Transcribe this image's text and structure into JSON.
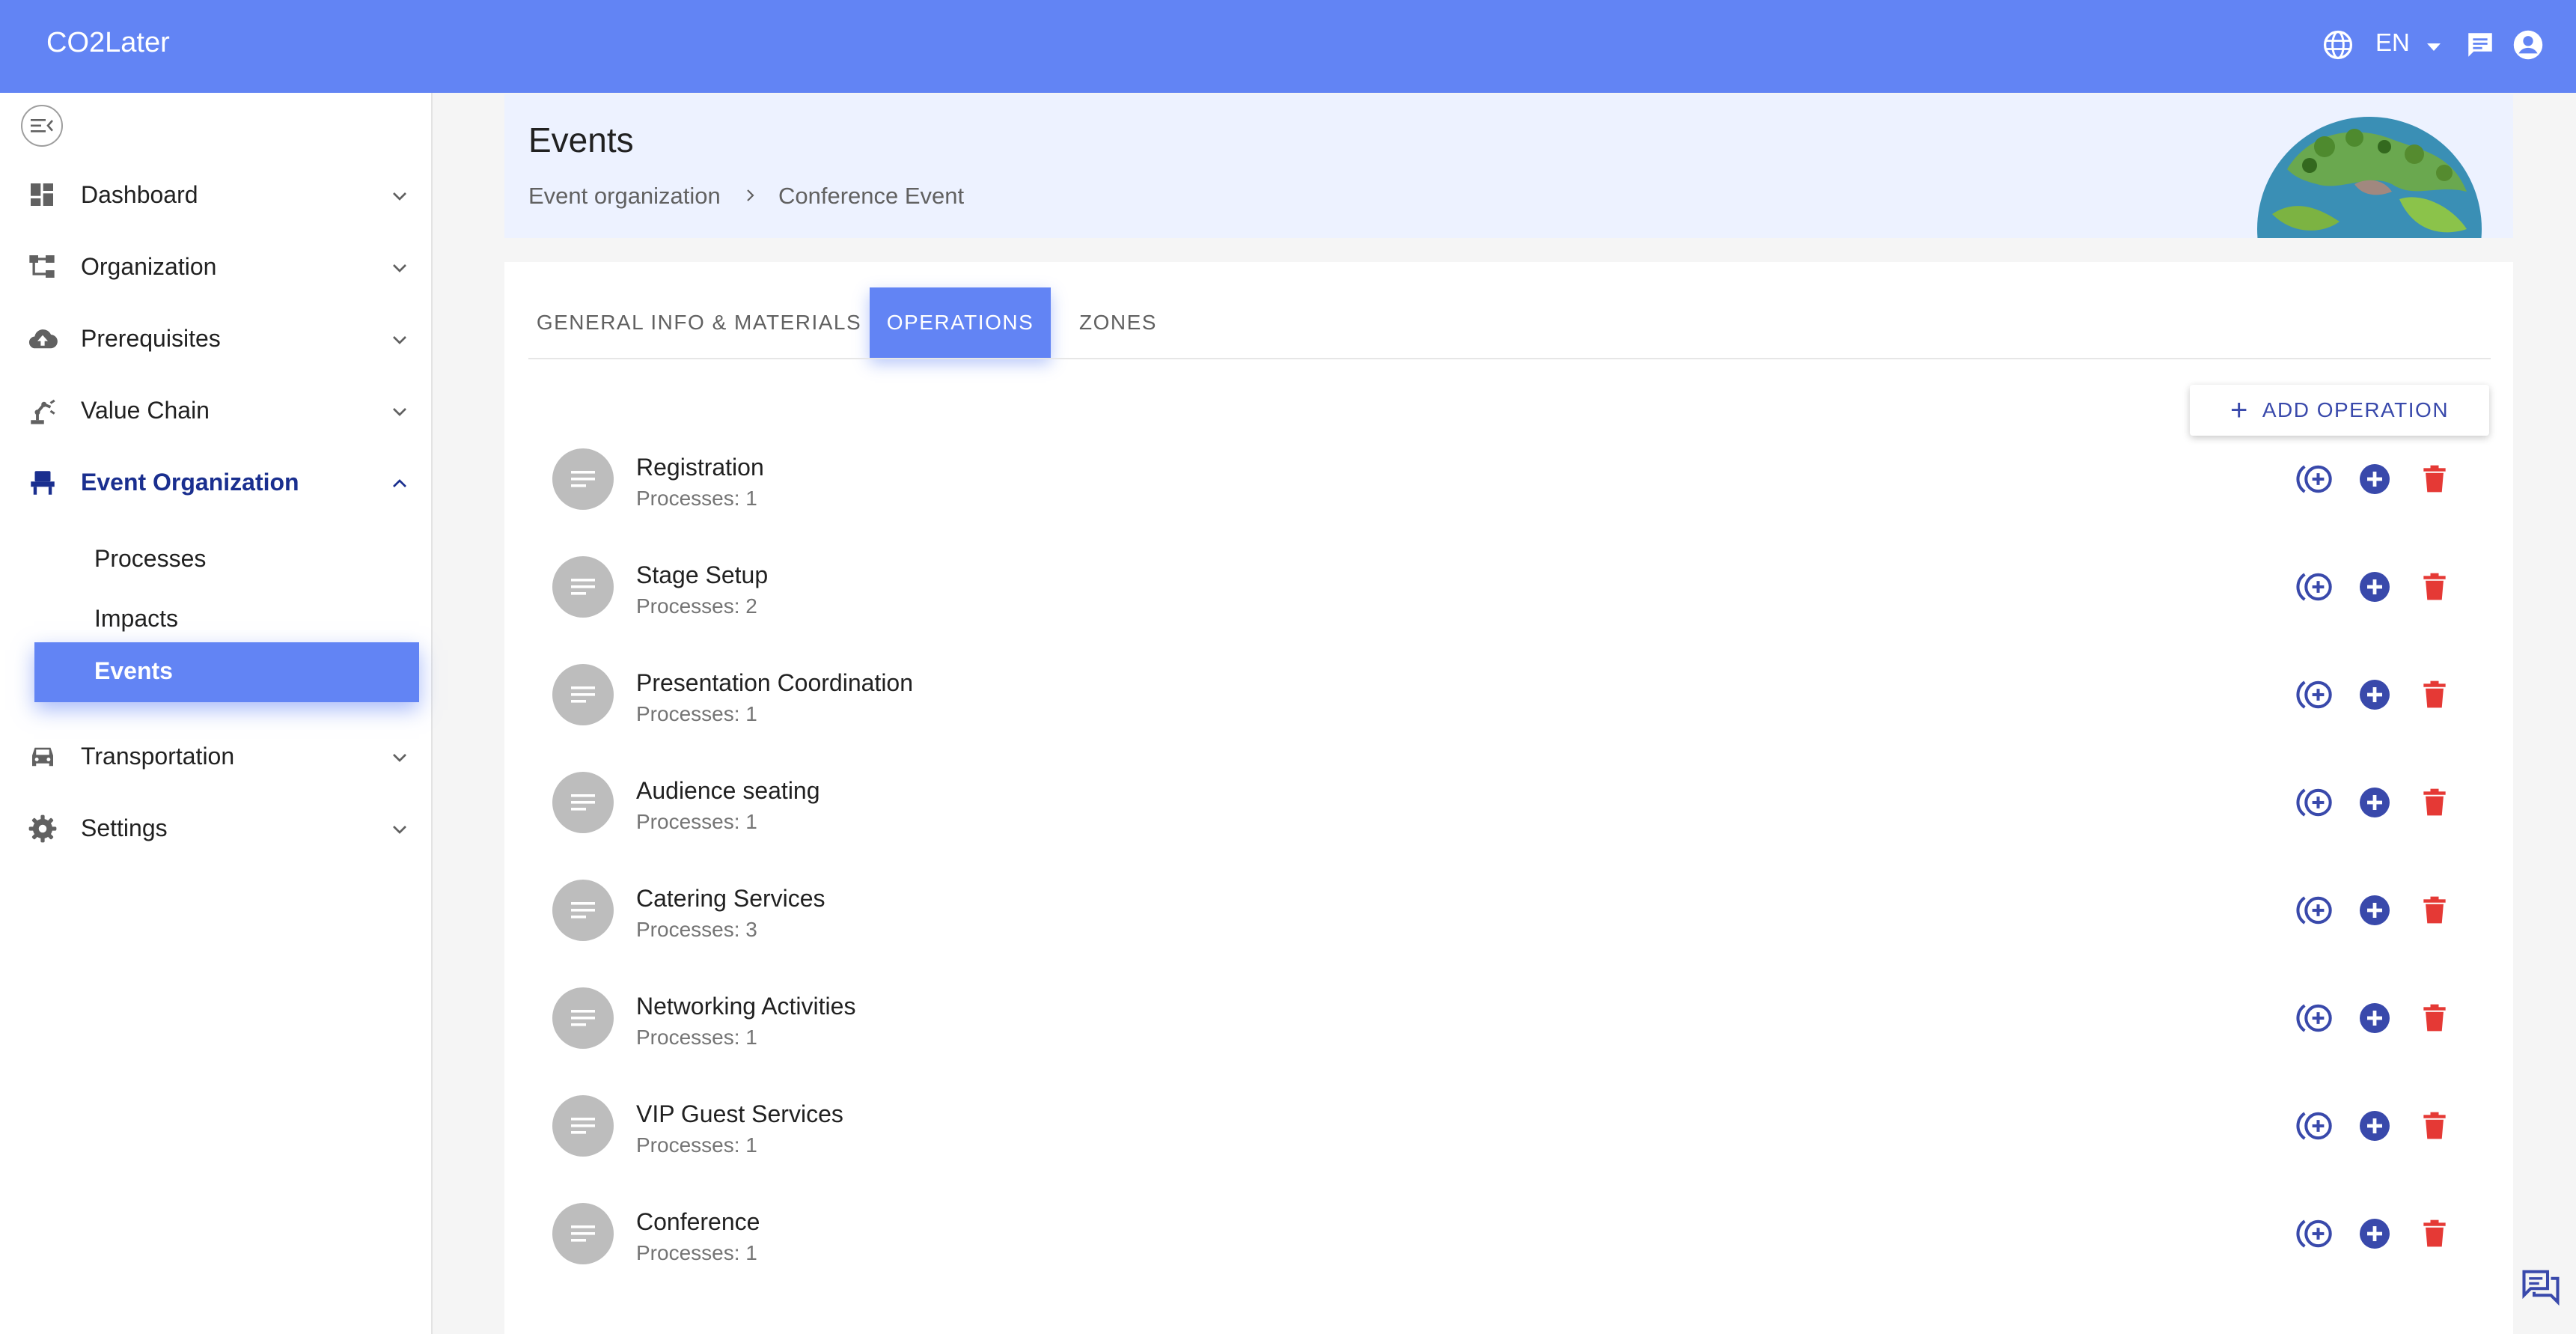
{
  "app": {
    "title": "CO2Later"
  },
  "topbar": {
    "language": "EN"
  },
  "sidebar": {
    "items": [
      {
        "label": "Dashboard",
        "icon": "dashboard-icon"
      },
      {
        "label": "Organization",
        "icon": "organization-icon"
      },
      {
        "label": "Prerequisites",
        "icon": "cloud-upload-icon"
      },
      {
        "label": "Value Chain",
        "icon": "robot-arm-icon"
      },
      {
        "label": "Event Organization",
        "icon": "event-seat-icon"
      },
      {
        "label": "Transportation",
        "icon": "car-icon"
      },
      {
        "label": "Settings",
        "icon": "gear-icon"
      }
    ],
    "subitems": [
      {
        "label": "Processes"
      },
      {
        "label": "Impacts"
      },
      {
        "label": "Events"
      }
    ]
  },
  "header": {
    "title": "Events",
    "breadcrumb": [
      "Event organization",
      "Conference Event"
    ]
  },
  "tabs": [
    {
      "label": "GENERAL INFO & MATERIALS"
    },
    {
      "label": "OPERATIONS"
    },
    {
      "label": "ZONES"
    }
  ],
  "actions": {
    "add_operation": "ADD OPERATION"
  },
  "operations": [
    {
      "name": "Registration",
      "processes": "Processes: 1"
    },
    {
      "name": "Stage Setup",
      "processes": "Processes: 2"
    },
    {
      "name": "Presentation Coordination",
      "processes": "Processes: 1"
    },
    {
      "name": "Audience seating",
      "processes": "Processes: 1"
    },
    {
      "name": "Catering Services",
      "processes": "Processes: 3"
    },
    {
      "name": "Networking Activities",
      "processes": "Processes: 1"
    },
    {
      "name": "VIP Guest Services",
      "processes": "Processes: 1"
    },
    {
      "name": "Conference",
      "processes": "Processes: 1"
    }
  ],
  "colors": {
    "primary": "#6284f4",
    "accent": "#3949ab",
    "danger": "#e53935"
  }
}
